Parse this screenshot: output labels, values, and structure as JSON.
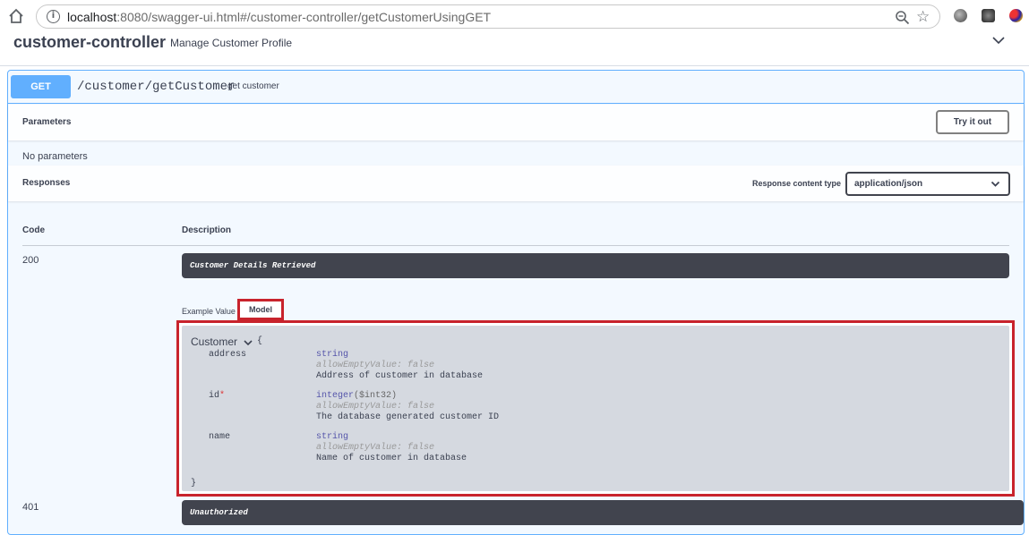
{
  "browser": {
    "url_host": "localhost",
    "url_rest": ":8080/swagger-ui.html#/customer-controller/getCustomerUsingGET"
  },
  "tag": {
    "title": "customer-controller",
    "description": "Manage Customer Profile"
  },
  "operation": {
    "method": "GET",
    "path": "/customer/getCustomer",
    "summary": "get customer",
    "parameters_label": "Parameters",
    "try_button": "Try it out",
    "no_params": "No parameters",
    "responses_label": "Responses",
    "content_type_label": "Response content type",
    "content_type_value": "application/json"
  },
  "responses": {
    "code_header": "Code",
    "description_header": "Description",
    "rows": [
      {
        "code": "200",
        "description": "Customer Details Retrieved"
      },
      {
        "code": "401",
        "description": "Unauthorized"
      }
    ],
    "tabs": {
      "example": "Example Value",
      "model": "Model"
    }
  },
  "model": {
    "name": "Customer",
    "open_brace": "{",
    "close_brace": "}",
    "properties": [
      {
        "name": "address",
        "required": "",
        "type": "string",
        "format": "",
        "meta": "allowEmptyValue: false",
        "description": "Address of customer in database"
      },
      {
        "name": "id",
        "required": "*",
        "type": "integer",
        "format": "($int32)",
        "meta": "allowEmptyValue: false",
        "description": "The database generated customer ID"
      },
      {
        "name": "name",
        "required": "",
        "type": "string",
        "format": "",
        "meta": "allowEmptyValue: false",
        "description": "Name of customer in database"
      }
    ]
  },
  "colors": {
    "get_accent": "#61affe",
    "highlight_red": "#c8232c",
    "dark_bar": "#41444e"
  }
}
